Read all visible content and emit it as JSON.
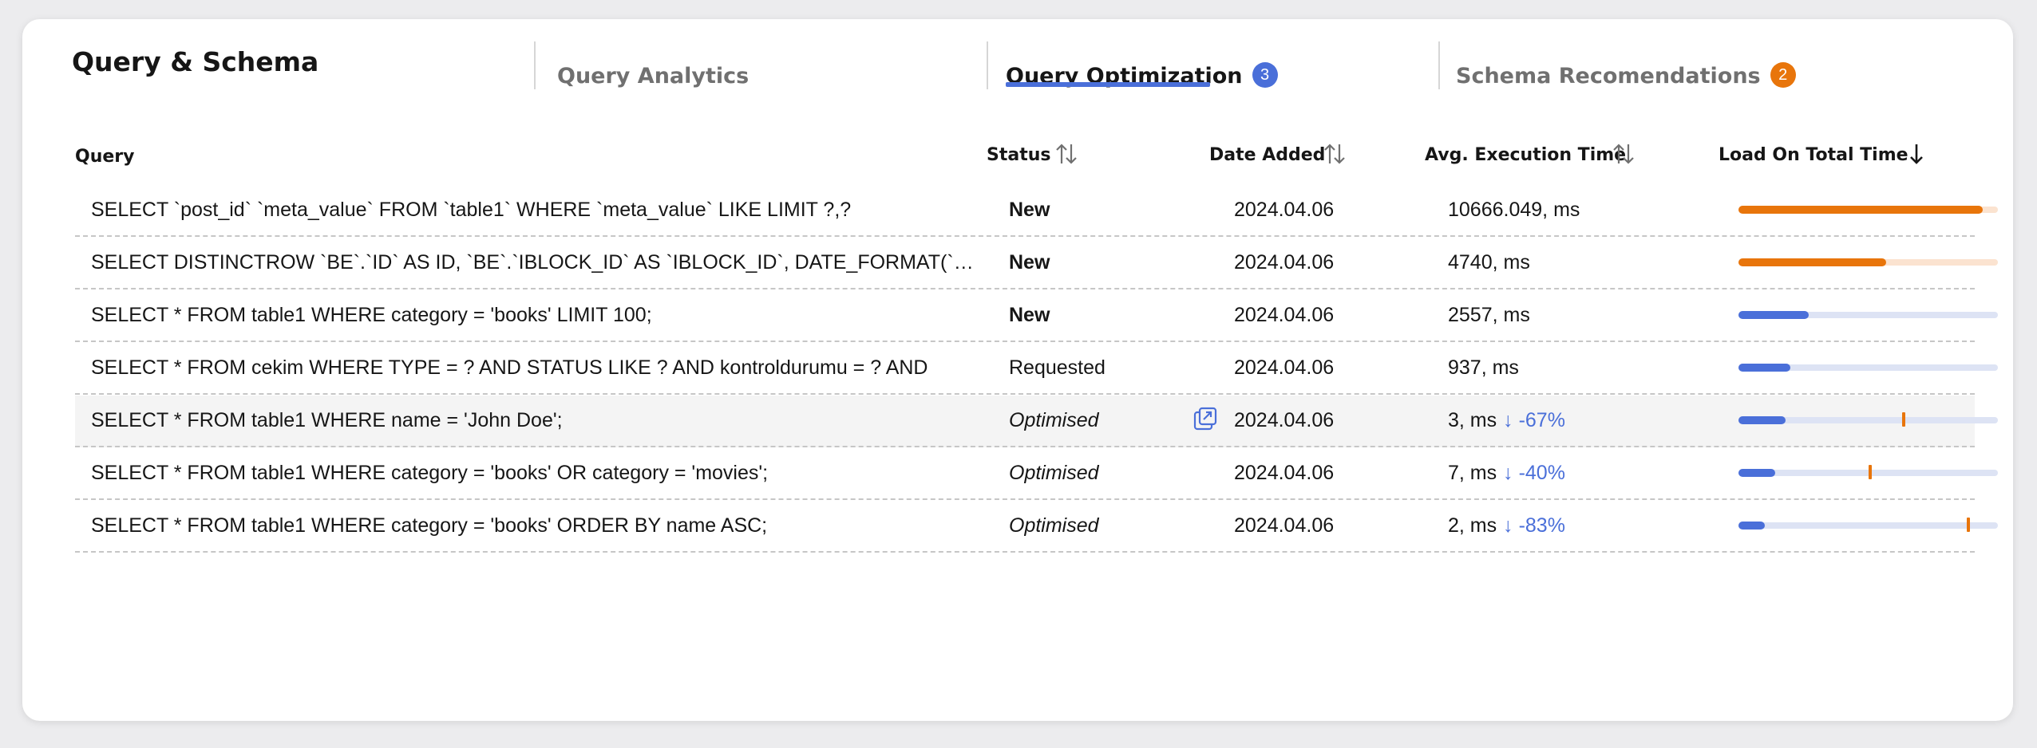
{
  "page_title": "Query & Schema",
  "tabs": [
    {
      "label": "Query Analytics",
      "state": "inactive"
    },
    {
      "label": "Query Optimization",
      "badge": "3",
      "badge_color": "#4a6fd9",
      "state": "active"
    },
    {
      "label": "Schema Recomendations",
      "badge": "2",
      "badge_color": "#e8750b",
      "state": "inactive"
    }
  ],
  "columns": {
    "query": "Query",
    "status": "Status",
    "date": "Date Added",
    "avg_time": "Avg. Execution Time",
    "load": "Load On Total Time"
  },
  "colors": {
    "accent": "#4a6fd9",
    "orange": "#e8750b",
    "orange_track": "#fbe3d0",
    "blue_track": "#dde3f4"
  },
  "rows": [
    {
      "query": "SELECT `post_id` `meta_value` FROM `table1` WHERE `meta_value` LIKE LIMIT ?,?",
      "status": "New",
      "date": "2024.04.06",
      "time": "10666.049, ms",
      "delta": "",
      "load": 0.94,
      "bar": "orange"
    },
    {
      "query": "SELECT DISTINCTROW `BE`.`ID` AS ID, `BE`.`IBLOCK_ID` AS `IBLOCK_ID`,  DATE_FORMAT(`BE`.`ACTIVE_FROM`)",
      "status": "New",
      "date": "2024.04.06",
      "time": "4740, ms",
      "delta": "",
      "load": 0.57,
      "bar": "orange"
    },
    {
      "query": "SELECT * FROM table1 WHERE category = 'books' LIMIT 100;",
      "status": "New",
      "date": "2024.04.06",
      "time": "2557, ms",
      "delta": "",
      "load": 0.27,
      "bar": "blue"
    },
    {
      "query": "SELECT * FROM cekim WHERE TYPE = ? AND STATUS LIKE ? AND kontroldurumu = ? AND",
      "status": "Requested",
      "date": "2024.04.06",
      "time": "937, ms",
      "delta": "",
      "load": 0.2,
      "bar": "blue"
    },
    {
      "query": "SELECT * FROM table1 WHERE name = 'John Doe';",
      "status": "Optimised",
      "date": "2024.04.06",
      "time": "3, ms",
      "delta": "↓ -67%",
      "load": 0.18,
      "marker": 0.63,
      "bar": "blue",
      "highlight": true
    },
    {
      "query": "SELECT * FROM table1 WHERE category = 'books' OR category = 'movies';",
      "status": "Optimised",
      "date": "2024.04.06",
      "time": "7, ms",
      "delta": "↓ -40%",
      "load": 0.14,
      "marker": 0.5,
      "bar": "blue"
    },
    {
      "query": "SELECT * FROM table1 WHERE category = 'books' ORDER BY name ASC;",
      "status": "Optimised",
      "date": "2024.04.06",
      "time": "2, ms",
      "delta": "↓ -83%",
      "load": 0.1,
      "marker": 0.88,
      "bar": "blue"
    }
  ]
}
